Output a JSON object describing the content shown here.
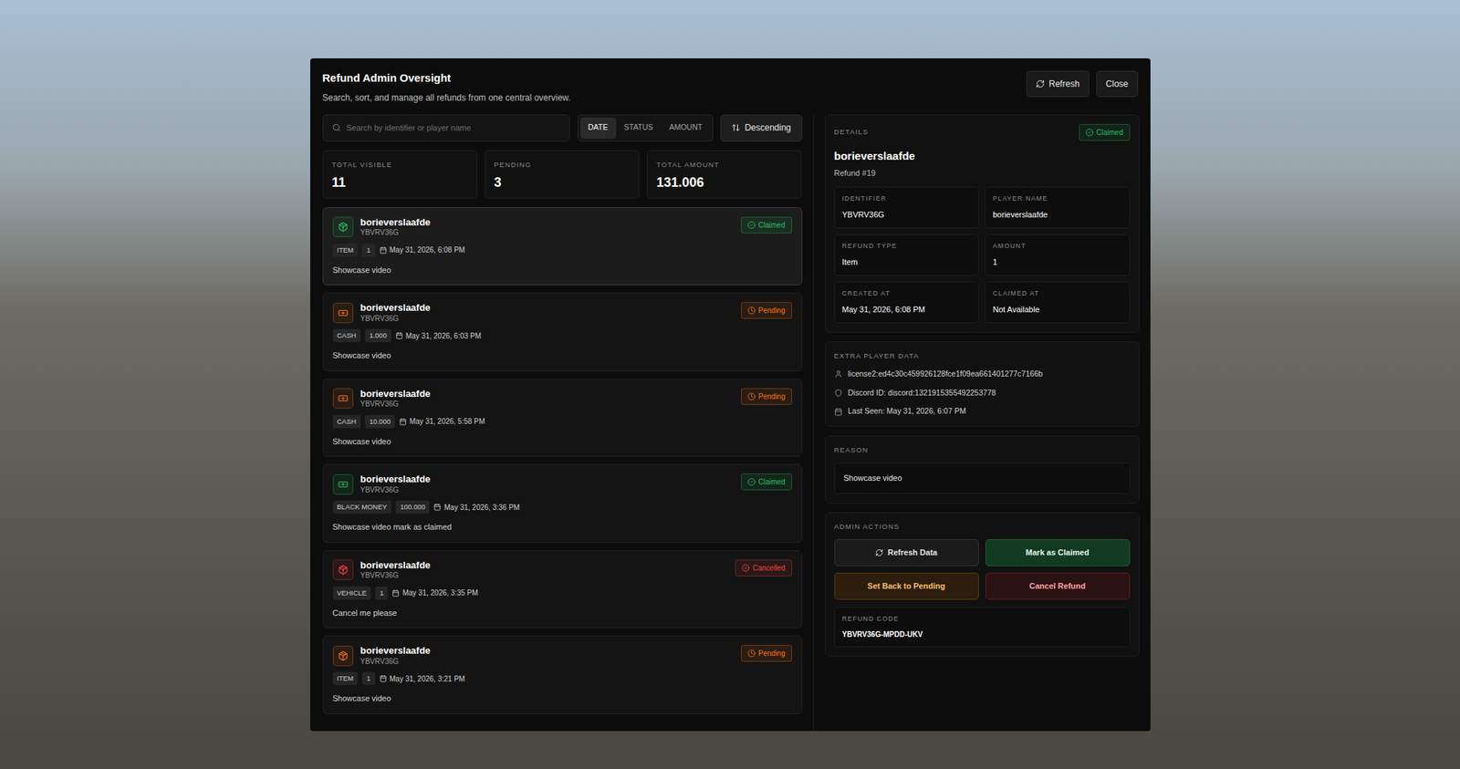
{
  "window": {
    "title": "Refund Admin Oversight",
    "subtitle": "Search, sort, and manage all refunds from one central overview.",
    "buttons": [
      {
        "label": "Refresh",
        "icon": "refresh"
      },
      {
        "label": "Close",
        "icon": "none"
      }
    ]
  },
  "search": {
    "placeholder": "Search by identifier or player name"
  },
  "sort_tabs": [
    {
      "label": "DATE",
      "selected": true
    },
    {
      "label": "STATUS",
      "selected": false
    },
    {
      "label": "AMOUNT",
      "selected": false
    }
  ],
  "sort_order": "Descending",
  "stats": [
    {
      "label": "TOTAL VISIBLE",
      "value": "11"
    },
    {
      "label": "PENDING",
      "value": "3"
    },
    {
      "label": "TOTAL AMOUNT",
      "value": "131.006"
    }
  ],
  "refunds": [
    {
      "name": "borieverslaafde",
      "identifier": "YBVRV36G",
      "kind": "item",
      "type": "ITEM",
      "amount": "1",
      "date": "May 31, 2026, 6:08 PM",
      "reason": "Showcase video",
      "status": "Claimed",
      "color": "#22c55e",
      "selected": true
    },
    {
      "name": "borieverslaafde",
      "identifier": "YBVRV36G",
      "kind": "cash",
      "type": "CASH",
      "amount": "1.000",
      "date": "May 31, 2026, 6:03 PM",
      "reason": "Showcase video",
      "status": "Pending",
      "color": "#f97316",
      "selected": false
    },
    {
      "name": "borieverslaafde",
      "identifier": "YBVRV36G",
      "kind": "cash",
      "type": "CASH",
      "amount": "10.000",
      "date": "May 31, 2026, 5:58 PM",
      "reason": "Showcase video",
      "status": "Pending",
      "color": "#f97316",
      "selected": false
    },
    {
      "name": "borieverslaafde",
      "identifier": "YBVRV36G",
      "kind": "cash",
      "type": "BLACK MONEY",
      "amount": "100.000",
      "date": "May 31, 2026, 3:36 PM",
      "reason": "Showcase video mark as claimed",
      "status": "Claimed",
      "color": "#22c55e",
      "selected": false
    },
    {
      "name": "borieverslaafde",
      "identifier": "YBVRV36G",
      "kind": "item",
      "type": "VEHICLE",
      "amount": "1",
      "date": "May 31, 2026, 3:35 PM",
      "reason": "Cancel me please",
      "status": "Cancelled",
      "color": "#ef4444",
      "selected": false
    },
    {
      "name": "borieverslaafde",
      "identifier": "YBVRV36G",
      "kind": "item",
      "type": "ITEM",
      "amount": "1",
      "date": "May 31, 2026, 3:21 PM",
      "reason": "Showcase video",
      "status": "Pending",
      "color": "#f97316",
      "selected": false
    }
  ],
  "details": {
    "label": "DETAILS",
    "status": "Claimed",
    "status_color": "#22c55e",
    "name": "borieverslaafde",
    "subtitle": "Refund #19",
    "fields": [
      {
        "label": "IDENTIFIER",
        "value": "YBVRV36G"
      },
      {
        "label": "PLAYER NAME",
        "value": "borieverslaafde"
      },
      {
        "label": "REFUND TYPE",
        "value": "Item"
      },
      {
        "label": "AMOUNT",
        "value": "1"
      },
      {
        "label": "CREATED AT",
        "value": "May 31, 2026, 6:08 PM"
      },
      {
        "label": "CLAIMED AT",
        "value": "Not Available"
      }
    ]
  },
  "extra_player_data": {
    "label": "EXTRA PLAYER DATA",
    "items": [
      {
        "kind": "user",
        "text": "license2:ed4c30c459926128fce1f09ea661401277c7166b"
      },
      {
        "kind": "shield",
        "text": "Discord ID: discord:1321915355492253778"
      },
      {
        "kind": "calendar",
        "text": "Last Seen: May 31, 2026, 6:07 PM"
      }
    ]
  },
  "reason": {
    "label": "REASON",
    "value": "Showcase video"
  },
  "admin_actions": {
    "label": "ADMIN ACTIONS",
    "buttons": [
      {
        "label": "Refresh Data",
        "kind": "neutral"
      },
      {
        "label": "Mark as Claimed",
        "kind": "success"
      },
      {
        "label": "Set Back to Pending",
        "kind": "warning"
      },
      {
        "label": "Cancel Refund",
        "kind": "danger"
      }
    ],
    "code_label": "REFUND CODE",
    "code": "YBVRV36G-MPDD-UKV"
  }
}
